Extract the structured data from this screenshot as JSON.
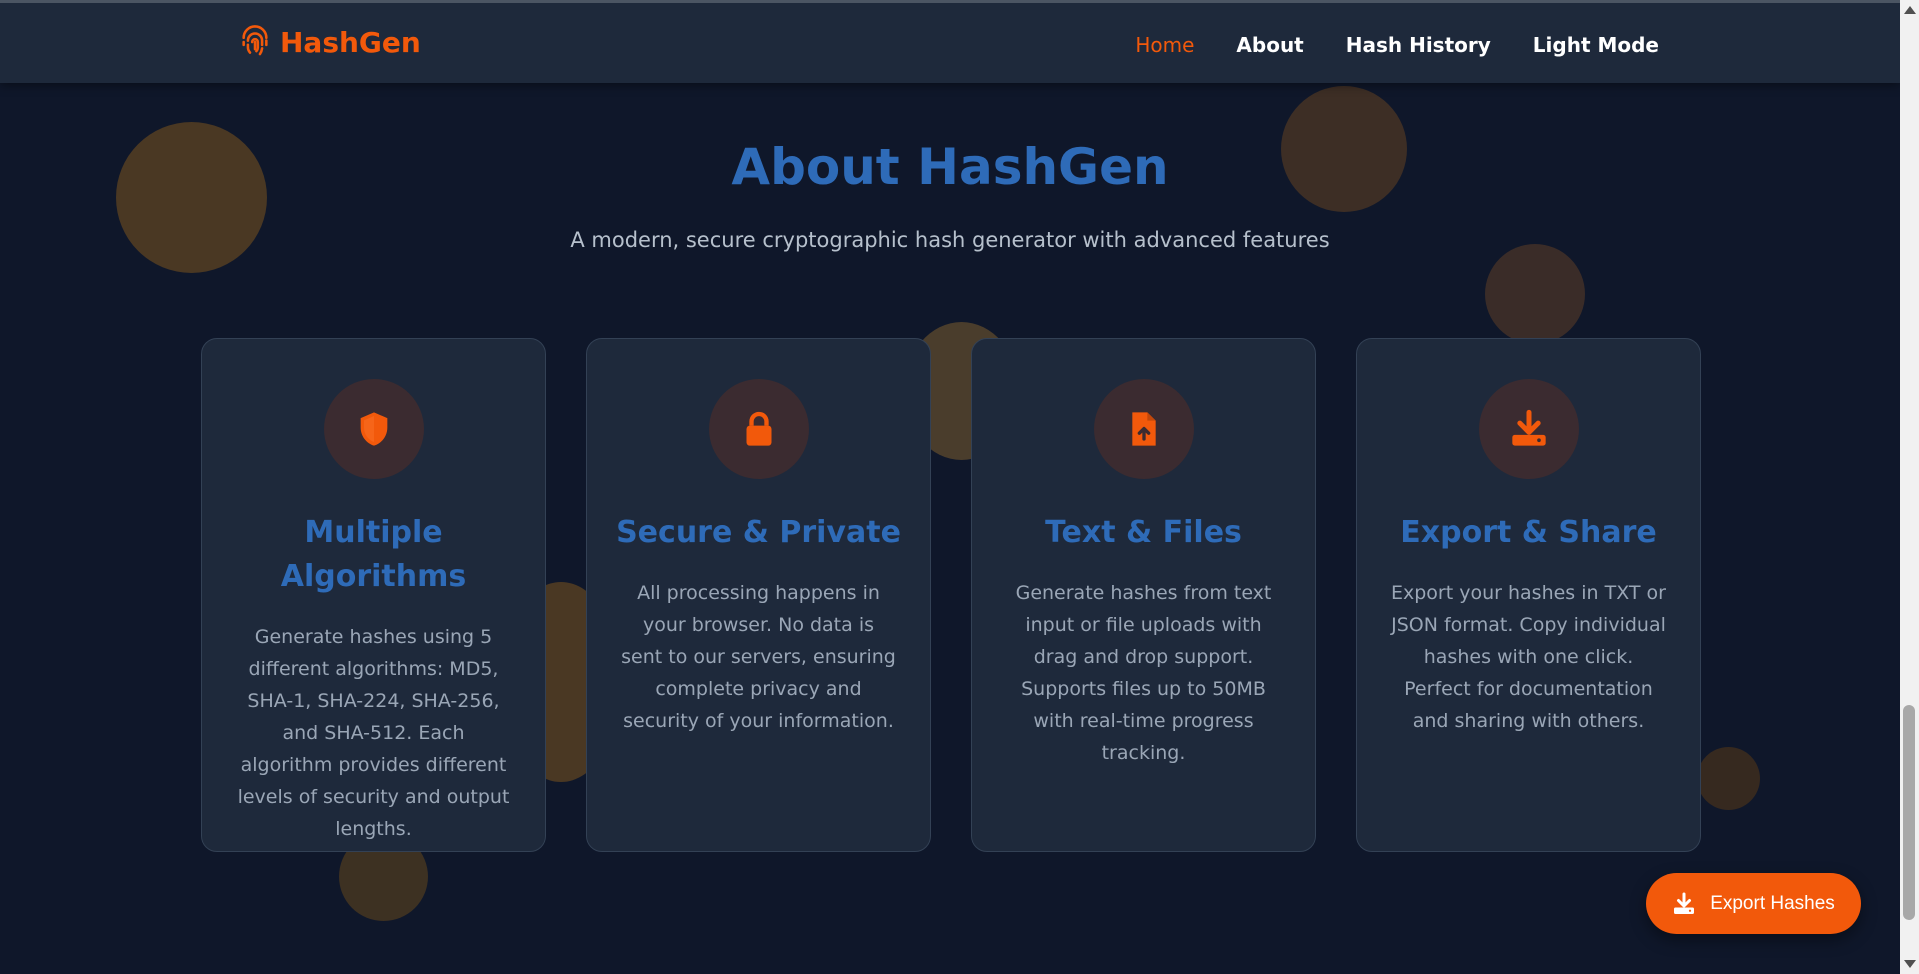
{
  "brand": {
    "name": "HashGen",
    "icon": "fingerprint-icon"
  },
  "nav": {
    "items": [
      {
        "label": "Home",
        "active": true
      },
      {
        "label": "About",
        "active": false
      },
      {
        "label": "Hash History",
        "active": false
      },
      {
        "label": "Light Mode",
        "active": false
      }
    ]
  },
  "hero": {
    "title": "About HashGen",
    "subtitle": "A modern, secure cryptographic hash generator with advanced features"
  },
  "features": [
    {
      "icon": "shield-icon",
      "title": "Multiple Algorithms",
      "description": "Generate hashes using 5 different algorithms: MD5, SHA-1, SHA-224, SHA-256, and SHA-512. Each algorithm provides different levels of security and output lengths."
    },
    {
      "icon": "lock-icon",
      "title": "Secure & Private",
      "description": "All processing happens in your browser. No data is sent to our servers, ensuring complete privacy and security of your information."
    },
    {
      "icon": "file-upload-icon",
      "title": "Text & Files",
      "description": "Generate hashes from text input or file uploads with drag and drop support. Supports files up to 50MB with real-time progress tracking."
    },
    {
      "icon": "download-icon",
      "title": "Export & Share",
      "description": "Export your hashes in TXT or JSON format. Copy individual hashes with one click. Perfect for documentation and sharing with others."
    }
  ],
  "export_button": {
    "label": "Export Hashes",
    "icon": "download-icon"
  },
  "colors": {
    "accent": "#f2590b",
    "heading": "#2e6bb8",
    "background": "#0f172a",
    "card": "#1e293b"
  }
}
